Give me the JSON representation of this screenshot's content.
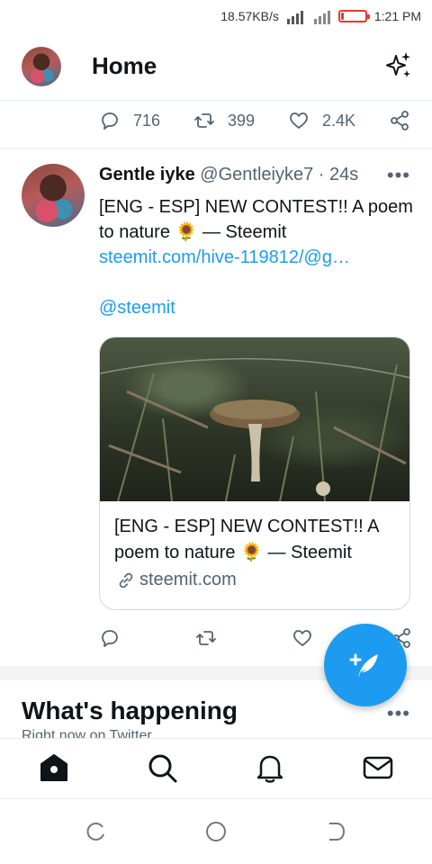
{
  "status_bar": {
    "speed": "18.57KB/s",
    "time": "1:21 PM",
    "battery_level": 0.1,
    "battery_color": "#e53935"
  },
  "header": {
    "title": "Home",
    "avatar_icon": "user-avatar",
    "sparkle_icon": "sparkle-icon"
  },
  "previous_tweet": {
    "replies": "716",
    "retweets": "399",
    "likes": "2.4K"
  },
  "tweet": {
    "name": "Gentle iyke",
    "handle": "@Gentleiyke7",
    "separator": " · ",
    "time": "24s",
    "text_line": "[ENG - ESP] NEW CONTEST!! A poem to nature 🌻 — Steemit",
    "link": "steemit.com/hive-119812/@g…",
    "mention": "@steemit",
    "card": {
      "title": "[ENG - ESP] NEW CONTEST!! A poem to nature 🌻 — Steemit",
      "domain": "steemit.com"
    }
  },
  "whats_happening": {
    "title": "What's happening",
    "subtitle": "Right now on Twitter"
  },
  "bottom_nav": [
    "home-icon",
    "search-icon",
    "bell-icon",
    "mail-icon"
  ],
  "accent_color": "#1d9bf0"
}
